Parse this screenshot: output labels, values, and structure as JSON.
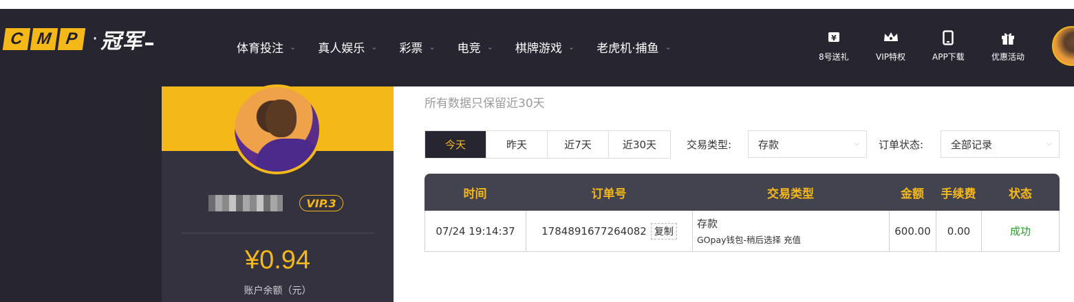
{
  "brand": {
    "logo_letters": [
      "C",
      "M",
      "P"
    ],
    "logo_dot": "·",
    "logo_cn": "冠军",
    "accent_color": "#f5b819",
    "nav_bg_color": "#262530"
  },
  "nav": {
    "menu": [
      {
        "label": "体育投注",
        "icon": "chevron-down-icon"
      },
      {
        "label": "真人娱乐",
        "icon": "chevron-down-icon"
      },
      {
        "label": "彩票",
        "icon": "chevron-down-icon"
      },
      {
        "label": "电竞",
        "icon": "chevron-down-icon"
      },
      {
        "label": "棋牌游戏",
        "icon": "chevron-down-icon"
      },
      {
        "label": "老虎机·捕鱼",
        "icon": "chevron-down-icon"
      }
    ],
    "chevron": "⌄",
    "quick_links": [
      {
        "label": "8号送礼",
        "icon": "ticket-icon",
        "glyph": "🎫"
      },
      {
        "label": "VIP特权",
        "icon": "crown-icon",
        "glyph": "♛"
      },
      {
        "label": "APP下载",
        "icon": "phone-icon",
        "glyph": "▯"
      },
      {
        "label": "优惠活动",
        "icon": "gift-icon",
        "glyph": "🎁"
      }
    ]
  },
  "profile": {
    "vip_label": "VIP.3",
    "balance": "¥0.94",
    "balance_label": "账户余额（元）"
  },
  "records": {
    "notice": "所有数据只保留近30天",
    "date_tabs": [
      {
        "label": "今天",
        "active": true
      },
      {
        "label": "昨天",
        "active": false
      },
      {
        "label": "近7天",
        "active": false
      },
      {
        "label": "近30天",
        "active": false
      }
    ],
    "type_filter_label": "交易类型:",
    "type_filter_value": "存款",
    "status_filter_label": "订单状态:",
    "status_filter_value": "全部记录",
    "select_arrow": "⌵",
    "columns": [
      "时间",
      "订单号",
      "交易类型",
      "金额",
      "手续费",
      "状态"
    ],
    "rows": [
      {
        "time": "07/24 19:14:37",
        "order_no": "1784891677264082",
        "copy_label": "复制",
        "type_main": "存款",
        "type_sub": "GOpay钱包-稍后选择 充值",
        "amount": "600.00",
        "fee": "0.00",
        "status": "成功",
        "status_color": "#2e9b2e"
      }
    ]
  }
}
